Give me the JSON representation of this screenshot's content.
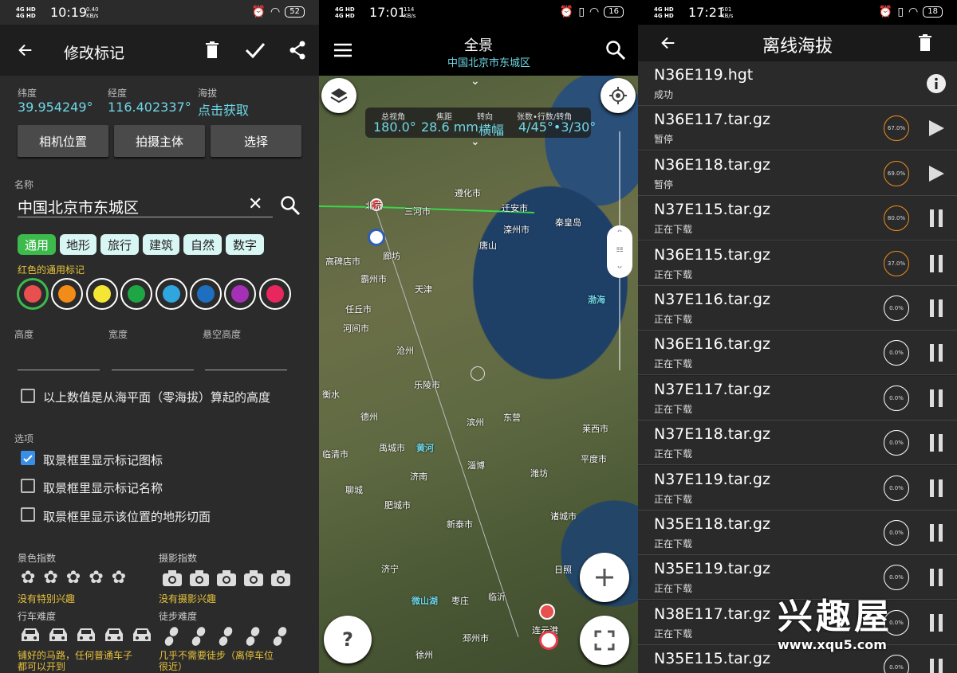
{
  "p1": {
    "status": {
      "sig": "4G HD\n4G HD",
      "time": "10:19",
      "kbs": "0.40\nKB/s",
      "battery": "52"
    },
    "title": "修改标记",
    "lat_label": "纬度",
    "lat": "39.954249°",
    "lon_label": "经度",
    "lon": "116.402337°",
    "alt_label": "海拔",
    "alt": "点击获取",
    "buttons": [
      "相机位置",
      "拍摄主体",
      "选择"
    ],
    "name_label": "名称",
    "name_value": "中国北京市东城区",
    "chips": [
      "通用",
      "地形",
      "旅行",
      "建筑",
      "自然",
      "数字"
    ],
    "color_label": "红色的通用标记",
    "colors": [
      "#e84f4f",
      "#f28c18",
      "#f4e632",
      "#1ea645",
      "#2fa6de",
      "#1f6fc0",
      "#a530b7",
      "#e8275f"
    ],
    "height_label": "高度",
    "width_label": "宽度",
    "hover_label": "悬空高度",
    "sea_check": "以上数值是从海平面（零海拔）算起的高度",
    "options_label": "选项",
    "opt1": "取景框里显示标记图标",
    "opt2": "取景框里显示标记名称",
    "opt3": "取景框里显示该位置的地形切面",
    "scenery_label": "景色指数",
    "scenery_value": "没有特别兴趣",
    "photo_label": "摄影指数",
    "photo_value": "没有摄影兴趣",
    "drive_label": "行车难度",
    "drive_value": "铺好的马路，任何普通车子都可以开到",
    "hike_label": "徒步难度",
    "hike_value": "几乎不需要徒步（离停车位很近）"
  },
  "p2": {
    "status": {
      "sig": "4G HD\n4G HD",
      "time": "17:01",
      "kbs": "114\nKB/s",
      "battery": "16"
    },
    "title": "全景",
    "subtitle": "中国北京市东城区",
    "info": [
      {
        "k": "总视角",
        "v": "180.0°"
      },
      {
        "k": "焦距",
        "v": "28.6 mm"
      },
      {
        "k": "转向",
        "v": "横幅"
      },
      {
        "k": "张数•行数/转角",
        "v": "4/45°•3/30°"
      }
    ],
    "cities": [
      {
        "n": "北京"
      },
      {
        "n": "三河市"
      },
      {
        "n": "遵化市"
      },
      {
        "n": "迁安市"
      },
      {
        "n": "秦皇岛"
      },
      {
        "n": "唐山"
      },
      {
        "n": "滦州市"
      },
      {
        "n": "廊坊"
      },
      {
        "n": "高碑店市"
      },
      {
        "n": "霸州市"
      },
      {
        "n": "天津"
      },
      {
        "n": "渤海"
      },
      {
        "n": "任丘市"
      },
      {
        "n": "河间市"
      },
      {
        "n": "沧州"
      },
      {
        "n": "衡水"
      },
      {
        "n": "乐陵市"
      },
      {
        "n": "德州"
      },
      {
        "n": "滨州"
      },
      {
        "n": "东营"
      },
      {
        "n": "禹城市"
      },
      {
        "n": "黄河"
      },
      {
        "n": "临清市"
      },
      {
        "n": "济南"
      },
      {
        "n": "淄博"
      },
      {
        "n": "潍坊"
      },
      {
        "n": "平度市"
      },
      {
        "n": "聊城"
      },
      {
        "n": "肥城市"
      },
      {
        "n": "新泰市"
      },
      {
        "n": "诸城市"
      },
      {
        "n": "济宁"
      },
      {
        "n": "临沂"
      },
      {
        "n": "日照"
      },
      {
        "n": "枣庄"
      },
      {
        "n": "微山湖"
      },
      {
        "n": "邳州市"
      },
      {
        "n": "徐州"
      },
      {
        "n": "连云港"
      },
      {
        "n": "莱西市"
      }
    ]
  },
  "p3": {
    "status": {
      "sig": "4G HD\n4G HD",
      "time": "17:21",
      "kbs": "501\nKB/s",
      "battery": "18"
    },
    "title": "离线海拔",
    "rows": [
      {
        "name": "N36E119.hgt",
        "status": "成功",
        "pct": "",
        "action": "info"
      },
      {
        "name": "N36E117.tar.gz",
        "status": "暂停",
        "pct": "67.0%",
        "action": "play"
      },
      {
        "name": "N36E118.tar.gz",
        "status": "暂停",
        "pct": "69.0%",
        "action": "play"
      },
      {
        "name": "N37E115.tar.gz",
        "status": "正在下载",
        "pct": "80.0%",
        "action": "pause"
      },
      {
        "name": "N36E115.tar.gz",
        "status": "正在下载",
        "pct": "37.0%",
        "action": "pause"
      },
      {
        "name": "N37E116.tar.gz",
        "status": "正在下载",
        "pct": "0.0%",
        "action": "pause"
      },
      {
        "name": "N36E116.tar.gz",
        "status": "正在下载",
        "pct": "0.0%",
        "action": "pause"
      },
      {
        "name": "N37E117.tar.gz",
        "status": "正在下载",
        "pct": "0.0%",
        "action": "pause"
      },
      {
        "name": "N37E118.tar.gz",
        "status": "正在下载",
        "pct": "0.0%",
        "action": "pause"
      },
      {
        "name": "N37E119.tar.gz",
        "status": "正在下载",
        "pct": "0.0%",
        "action": "pause"
      },
      {
        "name": "N35E118.tar.gz",
        "status": "正在下载",
        "pct": "0.0%",
        "action": "pause"
      },
      {
        "name": "N35E119.tar.gz",
        "status": "正在下载",
        "pct": "0.0%",
        "action": "pause"
      },
      {
        "name": "N38E117.tar.gz",
        "status": "正在下载",
        "pct": "0.0%",
        "action": "pause"
      },
      {
        "name": "N35E115.tar.gz",
        "status": "正在下载",
        "pct": "0.0%",
        "action": "pause"
      }
    ]
  },
  "watermark": {
    "big": "兴趣屋",
    "url": "www.xqu5.com"
  }
}
